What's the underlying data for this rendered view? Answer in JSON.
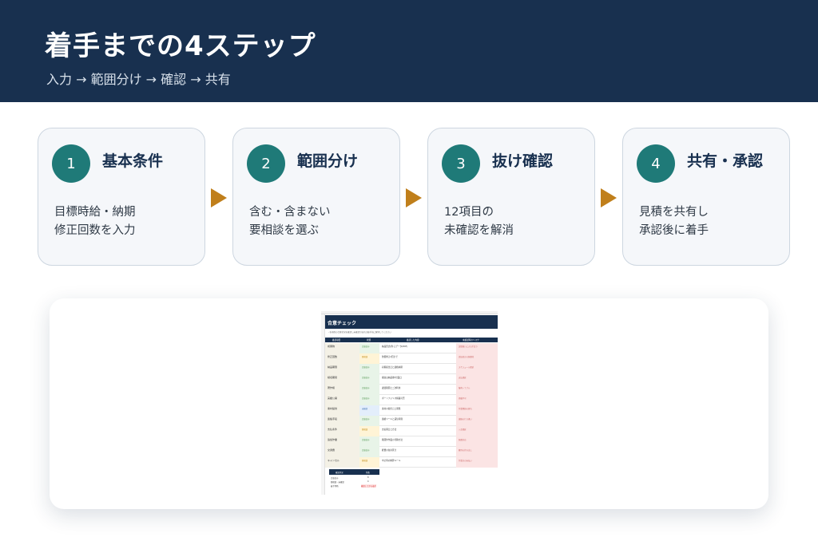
{
  "header": {
    "title": "着手までの4ステップ",
    "subtitle": "入力 → 範囲分け → 確認 → 共有"
  },
  "steps": [
    {
      "number": "1",
      "title": "基本条件",
      "desc": [
        "目標時給・納期",
        "修正回数を入力"
      ]
    },
    {
      "number": "2",
      "title": "範囲分け",
      "desc": [
        "含む・含まない",
        "要相談を選ぶ"
      ]
    },
    {
      "number": "3",
      "title": "抜け確認",
      "desc": [
        "12項目の",
        "未確認を解消"
      ]
    },
    {
      "number": "4",
      "title": "共有・承認",
      "desc": [
        "見積を共有し",
        "承認後に着手"
      ]
    }
  ],
  "colors": {
    "header_bg": "#18304f",
    "step_circle": "#1f7a78",
    "arrow": "#c07f1b",
    "card_bg": "#f5f7fa"
  },
  "spreadsheet": {
    "title": "合意チェック",
    "note": "・各項目の合意状況を確認し未確認があれば着手前に解消してください",
    "headers": [
      "確認項目",
      "状態",
      "確認した内容",
      "未確認時のリスク"
    ],
    "rows": [
      {
        "item": "成果物",
        "status": "合意済み",
        "content": "納品形式(例:元データ/PDF)",
        "risk": "認識違いによる手戻り"
      },
      {
        "item": "修正回数",
        "status": "要相談",
        "content": "無償修正2回まで",
        "risk": "追加修正の無償化"
      },
      {
        "item": "納品期限",
        "status": "合意済み",
        "content": "初稿提出日と最終納期",
        "risk": "スケジュール遅延"
      },
      {
        "item": "検収期間",
        "status": "合意済み",
        "content": "検収は納品後5営業日",
        "risk": "支払遅延"
      },
      {
        "item": "著作権",
        "status": "合意済み",
        "content": "譲渡範囲と二次利用",
        "risk": "権利トラブル"
      },
      {
        "item": "実績公開",
        "status": "合意済み",
        "content": "ポートフォリオ掲載可否",
        "risk": "掲載不可"
      },
      {
        "item": "素材提供",
        "status": "未確認",
        "content": "素材の提供元と期限",
        "risk": "作業開始の遅れ"
      },
      {
        "item": "連絡手段",
        "status": "合意済み",
        "content": "連絡ツールと返信時間",
        "risk": "連絡の行き違い"
      },
      {
        "item": "支払条件",
        "status": "要相談",
        "content": "支払期日と方法",
        "risk": "入金遅延"
      },
      {
        "item": "追加作業",
        "status": "合意済み",
        "content": "範囲外作業の見積方法",
        "risk": "無償対応"
      },
      {
        "item": "交通費",
        "status": "合意済み",
        "content": "経費の負担区分",
        "risk": "費用の持ち出し"
      },
      {
        "item": "キャンセル",
        "status": "要相談",
        "content": "中止時の精算ルール",
        "risk": "作業分の未払い"
      }
    ],
    "summary": {
      "headers": [
        "確認状況",
        "件数"
      ],
      "rows": [
        {
          "label": "合意済み",
          "value": "8"
        },
        {
          "label": "要相談・未確認",
          "value": "4"
        },
        {
          "label": "着手判断",
          "value": "確認してから着手",
          "alert": true
        }
      ]
    }
  }
}
